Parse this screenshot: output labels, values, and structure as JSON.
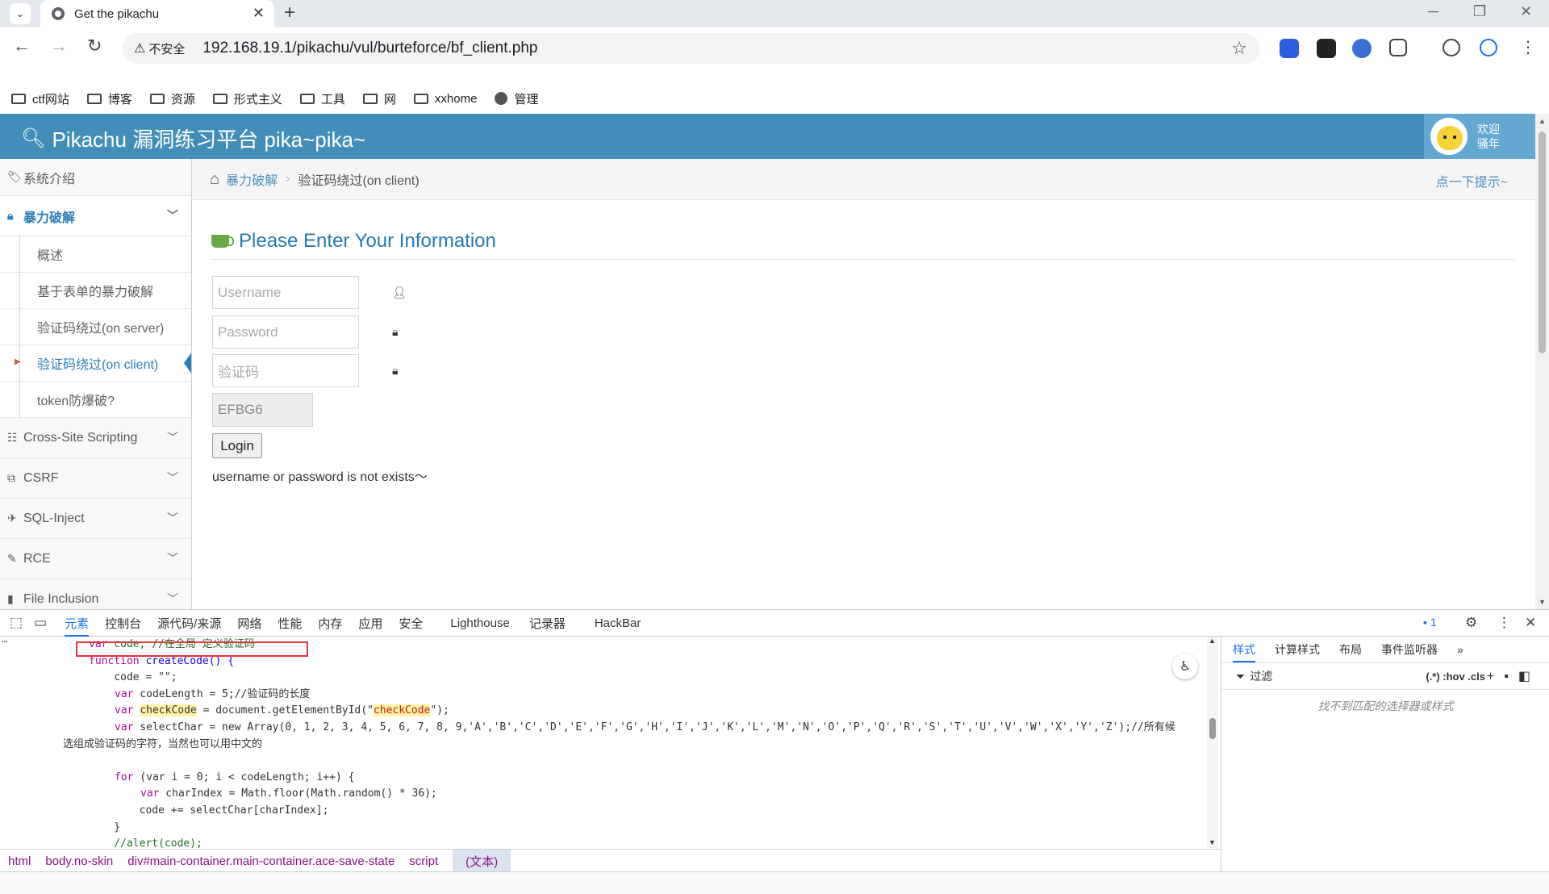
{
  "browser": {
    "tab_title": "Get the pikachu",
    "new_tab": "+",
    "security_label": "不安全",
    "url": "192.168.19.1/pikachu/vul/burteforce/bf_client.php",
    "bookmarks": [
      "ctf网站",
      "博客",
      "资源",
      "形式主义",
      "工具",
      "网",
      "xxhome",
      "管理"
    ]
  },
  "colors": {
    "header": "#438eb9",
    "accent": "#2b7dbc",
    "link": "#4c8fbd"
  },
  "page": {
    "brand": "Pikachu 漏洞练习平台 pika~pika~",
    "welcome_line1": "欢迎",
    "welcome_line2": "骚年",
    "breadcrumb_link": "暴力破解",
    "breadcrumb_current": "验证码绕过(on client)",
    "hint": "点一下提示~",
    "form_title": "Please Enter Your Information",
    "username_placeholder": "Username",
    "password_placeholder": "Password",
    "captcha_placeholder": "验证码",
    "captcha_value": "EFBG6",
    "login_label": "Login",
    "message": "username or password is not exists～"
  },
  "sidebar": {
    "intro": "系统介绍",
    "section": "暴力破解",
    "subitems": [
      "概述",
      "基于表单的暴力破解",
      "验证码绕过(on server)",
      "验证码绕过(on client)",
      "token防爆破?"
    ],
    "others": [
      "Cross-Site Scripting",
      "CSRF",
      "SQL-Inject",
      "RCE",
      "File Inclusion"
    ]
  },
  "devtools": {
    "tabs": [
      "元素",
      "控制台",
      "源代码/来源",
      "网络",
      "性能",
      "内存",
      "应用",
      "安全",
      "Lighthouse",
      "记录器",
      "HackBar"
    ],
    "issues_count": "1",
    "breadcrumbs": [
      "html",
      "body.no-skin",
      "div#main-container.main-container.ace-save-state",
      "script",
      "(文本)"
    ],
    "side_tabs": [
      "样式",
      "计算样式",
      "布局",
      "事件监听器"
    ],
    "filter_label": "过滤",
    "filter_opts": "(.*)  :hov  .cls",
    "no_match": "找不到匹配的选择器或样式",
    "code": {
      "l1_kw": "var",
      "l1_rest": " code; //在全局 定义验证码",
      "l2_kw": "function",
      "l2_rest": " createCode() {",
      "l3": "    code = \"\";",
      "l4_kw": "var",
      "l4_rest": " codeLength = 5;//验证码的长度",
      "l5_kw": "var",
      "l5_var": "checkCode",
      "l5_mid": " = document.getElementById(\"",
      "l5_str": "checkCode",
      "l5_end": "\");",
      "l6_kw": "var",
      "l6_rest": " selectChar = new Array(0, 1, 2, 3, 4, 5, 6, 7, 8, 9,'A','B','C','D','E','F','G','H','I','J','K','L','M','N','O','P','Q','R','S','T','U','V','W','X','Y','Z');//所有候",
      "l7": "选组成验证码的字符，当然也可以用中文的",
      "l9_kw": "for",
      "l9_rest": " (var i = 0; i < codeLength; i++) {",
      "l10_kw": "var",
      "l10_rest": " charIndex = Math.floor(Math.random() * 36);",
      "l11": "        code += selectChar[charIndex];",
      "l12": "    }",
      "l13": "    //alert(code);"
    }
  }
}
